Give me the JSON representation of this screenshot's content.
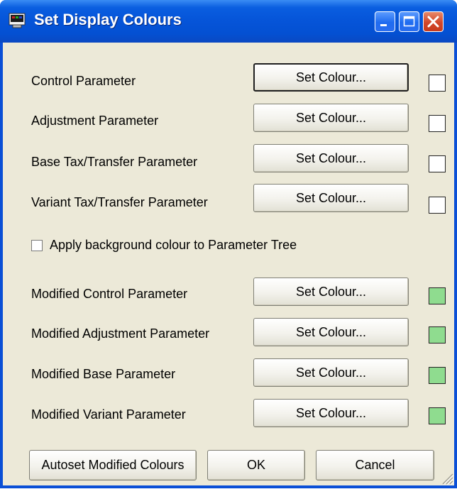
{
  "window": {
    "title": "Set Display Colours"
  },
  "rows": [
    {
      "label": "Control Parameter",
      "button": "Set Colour...",
      "swatch_color": "#ffffff"
    },
    {
      "label": "Adjustment Parameter",
      "button": "Set Colour...",
      "swatch_color": "#ffffff"
    },
    {
      "label": "Base Tax/Transfer Parameter",
      "button": "Set Colour...",
      "swatch_color": "#ffffff"
    },
    {
      "label": "Variant Tax/Transfer Parameter",
      "button": "Set Colour...",
      "swatch_color": "#ffffff"
    },
    {
      "label": "Modified Control Parameter",
      "button": "Set Colour...",
      "swatch_color": "#8fdc8f"
    },
    {
      "label": "Modified Adjustment Parameter",
      "button": "Set Colour...",
      "swatch_color": "#8fdc8f"
    },
    {
      "label": "Modified Base Parameter",
      "button": "Set Colour...",
      "swatch_color": "#8fdc8f"
    },
    {
      "label": "Modified Variant Parameter",
      "button": "Set Colour...",
      "swatch_color": "#8fdc8f"
    }
  ],
  "checkbox": {
    "label": "Apply background colour to Parameter Tree",
    "checked": false
  },
  "footer": {
    "autoset_label": "Autoset Modified Colours",
    "ok_label": "OK",
    "cancel_label": "Cancel"
  },
  "icons": {
    "app": "app-icon",
    "minimize": "minimize-icon",
    "maximize": "maximize-icon",
    "close": "close-icon",
    "resize": "resize-grip-icon"
  }
}
